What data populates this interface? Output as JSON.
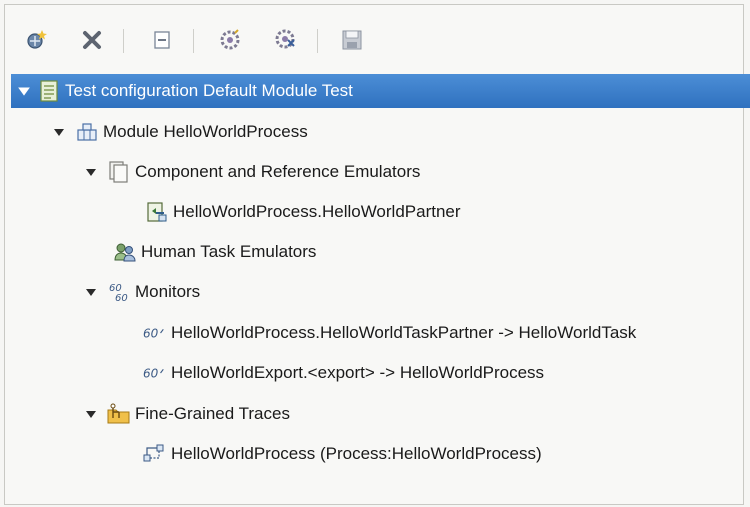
{
  "toolbar": {
    "buttons": [
      {
        "name": "add-icon"
      },
      {
        "name": "remove-icon"
      },
      {
        "name": "collapse-all-icon"
      },
      {
        "name": "enable-icon"
      },
      {
        "name": "disable-icon"
      },
      {
        "name": "save-icon"
      }
    ]
  },
  "tree": {
    "root": "Test configuration Default Module Test",
    "module": "Module HelloWorldProcess",
    "emulators": "Component and Reference Emulators",
    "partner": "HelloWorldProcess.HelloWorldPartner",
    "human_task": "Human Task Emulators",
    "monitors": "Monitors",
    "monitor_1": "HelloWorldProcess.HelloWorldTaskPartner -> HelloWorldTask",
    "monitor_2": "HelloWorldExport.<export> -> HelloWorldProcess",
    "traces": "Fine-Grained Traces",
    "trace_1": "HelloWorldProcess (Process:HelloWorldProcess)"
  },
  "colors": {
    "selection": "#3a7ccb",
    "background": "#f8f8f6"
  }
}
